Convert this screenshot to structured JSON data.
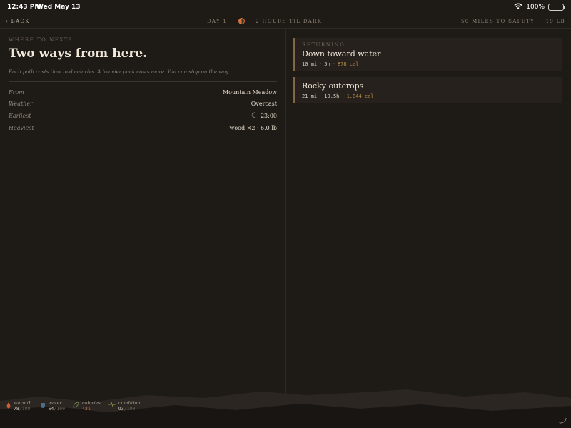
{
  "status_bar": {
    "time": "12:43 PM",
    "date": "Wed May 13",
    "battery": "100%"
  },
  "top_bar": {
    "back_label": "‹ back",
    "day": "DAY 1",
    "daylight": "2 HOURS TIL DARK",
    "distance": "50 MILES TO SAFETY",
    "weight": "19 LB"
  },
  "left": {
    "kicker": "WHERE TO NEXT?",
    "title": "Two ways from here.",
    "description": "Each path costs time and calories. A heavier pack costs more. You can stop on the way.",
    "rows": [
      {
        "label": "From",
        "value": "Mountain Meadow"
      },
      {
        "label": "Weather",
        "value": "Overcast"
      },
      {
        "label": "Earliest",
        "value": "23:00",
        "icon": "moon-icon"
      },
      {
        "label": "Heaviest",
        "value": "wood ×2 · 6.0 lb"
      }
    ]
  },
  "routes": [
    {
      "tag": "RETURNING",
      "name": "Down toward water",
      "distance": "10 mi",
      "time": "5h",
      "calories": "878 cal"
    },
    {
      "tag": "",
      "name": "Rocky outcrops",
      "distance": "21 mi",
      "time": "10.5h",
      "calories": "1,844 cal"
    }
  ],
  "vitals": [
    {
      "name": "warmth",
      "value": "78",
      "max": "/100",
      "icon": "flame-icon",
      "color": "#cc5f3b"
    },
    {
      "name": "water",
      "value": "64",
      "max": "/100",
      "icon": "water-cup-icon",
      "color": "#4e6d84"
    },
    {
      "name": "calories",
      "value": "421",
      "max": "",
      "icon": "leaf-icon",
      "color": "#6b7e55"
    },
    {
      "name": "condition",
      "value": "93",
      "max": "/100",
      "icon": "pulse-icon",
      "color": "#8b8d4b"
    }
  ]
}
